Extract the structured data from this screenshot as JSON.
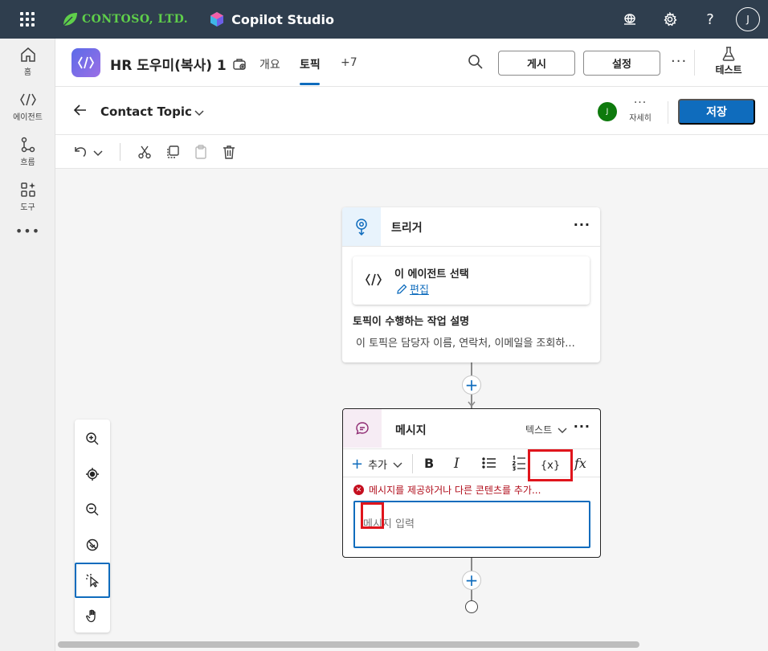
{
  "topbar": {
    "brand": "CONTOSO, LTD.",
    "product": "Copilot Studio",
    "avatar_initial": "J",
    "help": "?"
  },
  "rail": {
    "items": [
      {
        "label": "홈",
        "icon": "home-icon"
      },
      {
        "label": "에이전트",
        "icon": "agent-icon"
      },
      {
        "label": "흐름",
        "icon": "flow-icon"
      },
      {
        "label": "도구",
        "icon": "tools-icon"
      }
    ],
    "more": "•••"
  },
  "agent_header": {
    "title": "HR 도우미(복사) 1",
    "tabs": [
      {
        "label": "개요",
        "active": false
      },
      {
        "label": "토픽",
        "active": true
      },
      {
        "label": "+7",
        "active": false
      }
    ],
    "publish_label": "게시",
    "settings_label": "설정",
    "more": "···",
    "test_label": "테스트"
  },
  "topic_header": {
    "topic_name": "Contact Topic",
    "avatar_initial": "J",
    "details_dots": "···",
    "details_label": "자세히",
    "save_label": "저장"
  },
  "trigger_card": {
    "title": "트리거",
    "dots": "···",
    "agent_select_title": "이 에이전트 선택",
    "edit_label": "편집",
    "description_title": "토픽이 수행하는 작업 설명",
    "description_text": "이 토픽은 담당자 이름, 연락처, 이메일을 조회하..."
  },
  "message_card": {
    "title": "메시지",
    "type_label": "텍스트",
    "dots": "···",
    "add_label": "추가",
    "bold": "B",
    "italic": "I",
    "variable_label": "{x}",
    "formula_label": "fx",
    "error_text": "메시지를 제공하거나 다른 콘텐츠를 추가...",
    "input_placeholder": "메시지 입력"
  },
  "canvas": {
    "add": "+"
  },
  "colors": {
    "topbar": "#2f3e4e",
    "accent": "#0f6cbd",
    "highlight": "#e0151c",
    "error": "#c50f1f"
  }
}
